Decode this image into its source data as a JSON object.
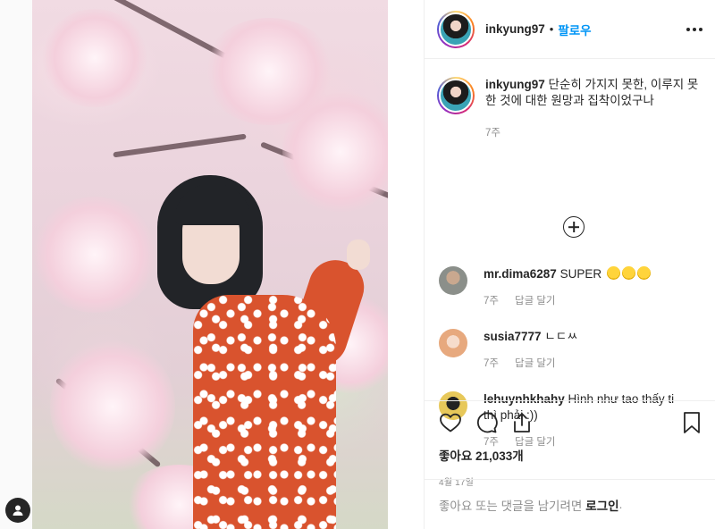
{
  "post": {
    "username": "inkyung97",
    "follow_label": "팔로우",
    "caption_text": "단순히 가지지 못한, 이루지 못한 것에 대한 원망과 집착이었구나",
    "caption_time": "7주",
    "likes_text": "좋아요 21,033개",
    "date_text": "4월 17일"
  },
  "comments": [
    {
      "username": "mr.dima6287",
      "text": "SUPER",
      "emoji_count": 3,
      "time": "7주",
      "reply_label": "답글 달기",
      "avatar_color": "#8b8f8a"
    },
    {
      "username": "susia7777",
      "text": "ㄴㄷㅆ",
      "time": "7주",
      "reply_label": "답글 달기",
      "avatar_color": "#f0c2a8"
    },
    {
      "username": "lehuynhkhahy",
      "text": "Hình như tao thấy ti thì phải :))",
      "time": "7주",
      "reply_label": "답글 달기",
      "avatar_color": "#d4b13a"
    }
  ],
  "login_bar": {
    "prefix": "좋아요 또는 댓글을 남기려면",
    "link": "로그인",
    "suffix": "."
  },
  "icons": {
    "like": "heart-icon",
    "comment": "comment-icon",
    "share": "share-icon",
    "save": "bookmark-icon",
    "more": "more-options-icon",
    "add": "load-more-comments-icon",
    "help": "user-icon"
  }
}
